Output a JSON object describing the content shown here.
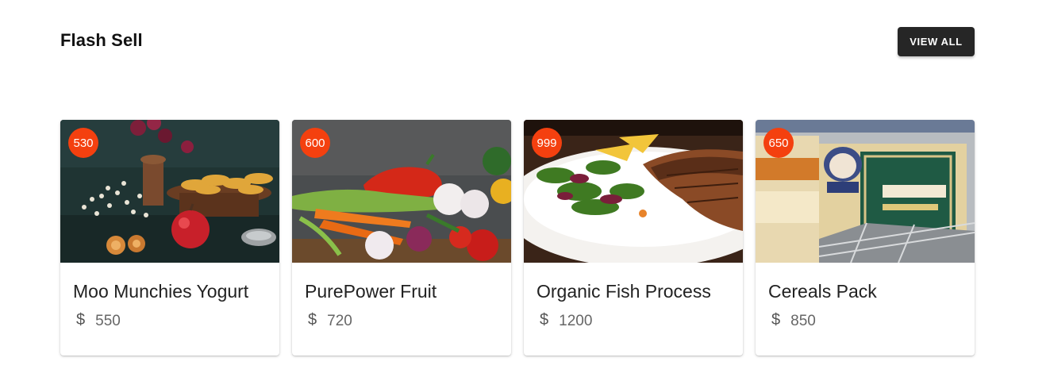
{
  "section": {
    "title": "Flash Sell",
    "view_all_label": "VIEW ALL"
  },
  "colors": {
    "badge": "#f4400f",
    "button": "#262626"
  },
  "products": [
    {
      "badge": "530",
      "name": "Moo Munchies Yogurt",
      "currency_icon": "dollar-icon",
      "currency_symbol": "$",
      "price": "550",
      "image": "dried-fruit-and-apple-photo"
    },
    {
      "badge": "600",
      "name": "PurePower Fruit",
      "currency_icon": "dollar-icon",
      "currency_symbol": "$",
      "price": "720",
      "image": "vegetables-photo"
    },
    {
      "badge": "999",
      "name": "Organic Fish Process",
      "currency_icon": "dollar-icon",
      "currency_symbol": "$",
      "price": "1200",
      "image": "fish-salad-plate-photo"
    },
    {
      "badge": "650",
      "name": "Cereals Pack",
      "currency_icon": "dollar-icon",
      "currency_symbol": "$",
      "price": "850",
      "image": "cereal-boxes-photo"
    }
  ]
}
